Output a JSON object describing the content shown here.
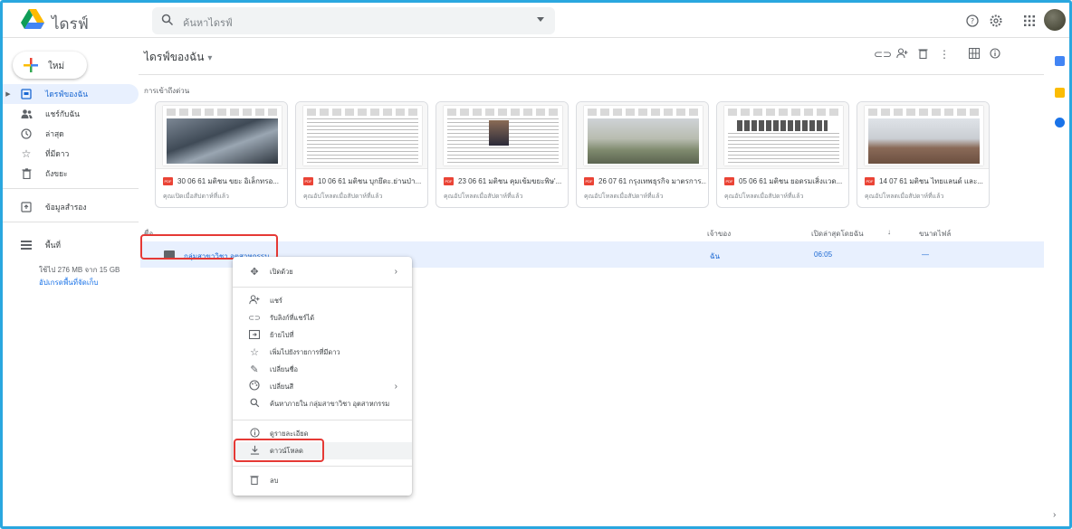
{
  "app": {
    "title": "ไดรฟ์"
  },
  "search": {
    "placeholder": "ค้นหาไดรฟ์"
  },
  "topbar": {
    "icons": [
      "help-icon",
      "settings-icon",
      "apps-grid-icon",
      "account-avatar"
    ]
  },
  "sidebar": {
    "new_label": "ใหม่",
    "items": [
      {
        "label": "ไดรฟ์ของฉัน",
        "icon": "my-drive-icon",
        "active": true
      },
      {
        "label": "แชร์กับฉัน",
        "icon": "shared-icon"
      },
      {
        "label": "ล่าสุด",
        "icon": "clock-icon"
      },
      {
        "label": "ที่มีดาว",
        "icon": "star-icon"
      },
      {
        "label": "ถังขยะ",
        "icon": "trash-icon"
      },
      {
        "label": "ข้อมูลสำรอง",
        "icon": "backup-icon"
      },
      {
        "label": "พื้นที่",
        "icon": "storage-icon"
      }
    ],
    "storage_text": "ใช้ไป 276 MB จาก 15 GB",
    "upgrade_link": "อัปเกรดพื้นที่จัดเก็บ"
  },
  "main": {
    "title": "ไดรฟ์ของฉัน",
    "quick_access_title": "การเข้าถึงด่วน",
    "cards": [
      {
        "name": "30 06 61 มติชน ขยะ อิเล็กทรอ...",
        "sub": "คุณเปิดเมื่อสัปดาห์ที่แล้ว"
      },
      {
        "name": "10 06 61 มติชน บุกยึดะ.ย่านป่า...",
        "sub": "คุณอัปโหลดเมื่อสัปดาห์ที่แล้ว"
      },
      {
        "name": "23 06 61 มติชน คุมเข้มขยะพิษ'...",
        "sub": "คุณอัปโหลดเมื่อสัปดาห์ที่แล้ว"
      },
      {
        "name": "26 07 61 กรุงเทพธุรกิจ มาตรการ...",
        "sub": "คุณอัปโหลดเมื่อสัปดาห์ที่แล้ว"
      },
      {
        "name": "05 06 61 มติชน ยอดรมเสิ่งแวด...",
        "sub": "คุณอัปโหลดเมื่อสัปดาห์ที่แล้ว"
      },
      {
        "name": "14 07 61 มติชน ไทยแลนด์ และ...",
        "sub": "คุณอัปโหลดเมื่อสัปดาห์ที่แล้ว"
      }
    ],
    "columns": {
      "name": "ชื่อ",
      "owner": "เจ้าของ",
      "modified": "เปิดล่าสุดโดยฉัน",
      "size": "ขนาดไฟล์"
    },
    "rows": [
      {
        "name": "กลุ่มสาขาวิชา อุตสาหกรรม",
        "owner": "ฉัน",
        "modified": "06:05",
        "size": "—"
      }
    ]
  },
  "context_menu": {
    "items": [
      {
        "label": "เปิดด้วย",
        "icon": "open-with-icon",
        "submenu": true
      },
      {
        "label": "แชร์",
        "icon": "share-icon"
      },
      {
        "label": "รับลิงก์ที่แชร์ได้",
        "icon": "link-icon"
      },
      {
        "label": "ย้ายไปที่",
        "icon": "move-icon"
      },
      {
        "label": "เพิ่มไปยังรายการที่มีดาว",
        "icon": "star-icon"
      },
      {
        "label": "เปลี่ยนชื่อ",
        "icon": "rename-icon"
      },
      {
        "label": "เปลี่ยนสี",
        "icon": "palette-icon",
        "submenu": true
      },
      {
        "label": "ค้นหาภายใน กลุ่มสาขาวิชา อุตสาหกรรม",
        "icon": "search-icon"
      },
      {
        "label": "ดูรายละเอียด",
        "icon": "info-icon"
      },
      {
        "label": "ดาวน์โหลด",
        "icon": "download-icon",
        "highlighted": true
      },
      {
        "label": "ลบ",
        "icon": "trash-icon"
      }
    ]
  },
  "colors": {
    "accent": "#1a73e8",
    "selection": "#e8f0fe",
    "highlight_box": "#e53935",
    "frame": "#2aa7df"
  }
}
